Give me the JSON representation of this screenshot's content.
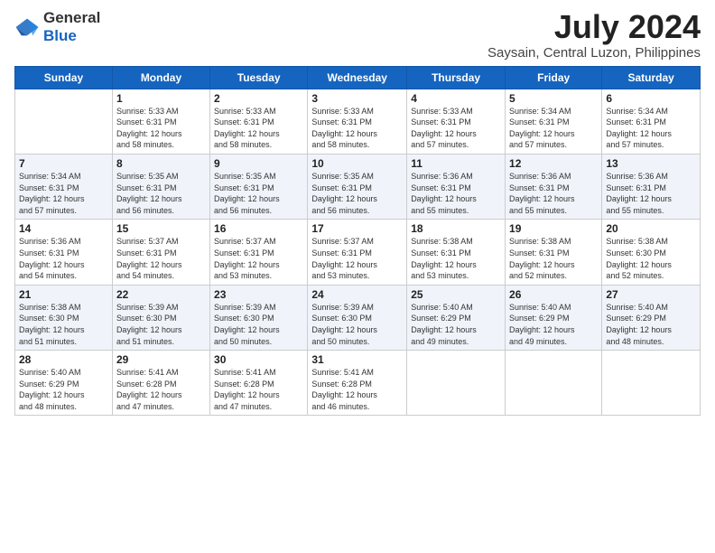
{
  "header": {
    "logo_general": "General",
    "logo_blue": "Blue",
    "month_year": "July 2024",
    "location": "Saysain, Central Luzon, Philippines"
  },
  "weekdays": [
    "Sunday",
    "Monday",
    "Tuesday",
    "Wednesday",
    "Thursday",
    "Friday",
    "Saturday"
  ],
  "weeks": [
    [
      {
        "day": "",
        "info": ""
      },
      {
        "day": "1",
        "info": "Sunrise: 5:33 AM\nSunset: 6:31 PM\nDaylight: 12 hours\nand 58 minutes."
      },
      {
        "day": "2",
        "info": "Sunrise: 5:33 AM\nSunset: 6:31 PM\nDaylight: 12 hours\nand 58 minutes."
      },
      {
        "day": "3",
        "info": "Sunrise: 5:33 AM\nSunset: 6:31 PM\nDaylight: 12 hours\nand 58 minutes."
      },
      {
        "day": "4",
        "info": "Sunrise: 5:33 AM\nSunset: 6:31 PM\nDaylight: 12 hours\nand 57 minutes."
      },
      {
        "day": "5",
        "info": "Sunrise: 5:34 AM\nSunset: 6:31 PM\nDaylight: 12 hours\nand 57 minutes."
      },
      {
        "day": "6",
        "info": "Sunrise: 5:34 AM\nSunset: 6:31 PM\nDaylight: 12 hours\nand 57 minutes."
      }
    ],
    [
      {
        "day": "7",
        "info": "Sunrise: 5:34 AM\nSunset: 6:31 PM\nDaylight: 12 hours\nand 57 minutes."
      },
      {
        "day": "8",
        "info": "Sunrise: 5:35 AM\nSunset: 6:31 PM\nDaylight: 12 hours\nand 56 minutes."
      },
      {
        "day": "9",
        "info": "Sunrise: 5:35 AM\nSunset: 6:31 PM\nDaylight: 12 hours\nand 56 minutes."
      },
      {
        "day": "10",
        "info": "Sunrise: 5:35 AM\nSunset: 6:31 PM\nDaylight: 12 hours\nand 56 minutes."
      },
      {
        "day": "11",
        "info": "Sunrise: 5:36 AM\nSunset: 6:31 PM\nDaylight: 12 hours\nand 55 minutes."
      },
      {
        "day": "12",
        "info": "Sunrise: 5:36 AM\nSunset: 6:31 PM\nDaylight: 12 hours\nand 55 minutes."
      },
      {
        "day": "13",
        "info": "Sunrise: 5:36 AM\nSunset: 6:31 PM\nDaylight: 12 hours\nand 55 minutes."
      }
    ],
    [
      {
        "day": "14",
        "info": "Sunrise: 5:36 AM\nSunset: 6:31 PM\nDaylight: 12 hours\nand 54 minutes."
      },
      {
        "day": "15",
        "info": "Sunrise: 5:37 AM\nSunset: 6:31 PM\nDaylight: 12 hours\nand 54 minutes."
      },
      {
        "day": "16",
        "info": "Sunrise: 5:37 AM\nSunset: 6:31 PM\nDaylight: 12 hours\nand 53 minutes."
      },
      {
        "day": "17",
        "info": "Sunrise: 5:37 AM\nSunset: 6:31 PM\nDaylight: 12 hours\nand 53 minutes."
      },
      {
        "day": "18",
        "info": "Sunrise: 5:38 AM\nSunset: 6:31 PM\nDaylight: 12 hours\nand 53 minutes."
      },
      {
        "day": "19",
        "info": "Sunrise: 5:38 AM\nSunset: 6:31 PM\nDaylight: 12 hours\nand 52 minutes."
      },
      {
        "day": "20",
        "info": "Sunrise: 5:38 AM\nSunset: 6:30 PM\nDaylight: 12 hours\nand 52 minutes."
      }
    ],
    [
      {
        "day": "21",
        "info": "Sunrise: 5:38 AM\nSunset: 6:30 PM\nDaylight: 12 hours\nand 51 minutes."
      },
      {
        "day": "22",
        "info": "Sunrise: 5:39 AM\nSunset: 6:30 PM\nDaylight: 12 hours\nand 51 minutes."
      },
      {
        "day": "23",
        "info": "Sunrise: 5:39 AM\nSunset: 6:30 PM\nDaylight: 12 hours\nand 50 minutes."
      },
      {
        "day": "24",
        "info": "Sunrise: 5:39 AM\nSunset: 6:30 PM\nDaylight: 12 hours\nand 50 minutes."
      },
      {
        "day": "25",
        "info": "Sunrise: 5:40 AM\nSunset: 6:29 PM\nDaylight: 12 hours\nand 49 minutes."
      },
      {
        "day": "26",
        "info": "Sunrise: 5:40 AM\nSunset: 6:29 PM\nDaylight: 12 hours\nand 49 minutes."
      },
      {
        "day": "27",
        "info": "Sunrise: 5:40 AM\nSunset: 6:29 PM\nDaylight: 12 hours\nand 48 minutes."
      }
    ],
    [
      {
        "day": "28",
        "info": "Sunrise: 5:40 AM\nSunset: 6:29 PM\nDaylight: 12 hours\nand 48 minutes."
      },
      {
        "day": "29",
        "info": "Sunrise: 5:41 AM\nSunset: 6:28 PM\nDaylight: 12 hours\nand 47 minutes."
      },
      {
        "day": "30",
        "info": "Sunrise: 5:41 AM\nSunset: 6:28 PM\nDaylight: 12 hours\nand 47 minutes."
      },
      {
        "day": "31",
        "info": "Sunrise: 5:41 AM\nSunset: 6:28 PM\nDaylight: 12 hours\nand 46 minutes."
      },
      {
        "day": "",
        "info": ""
      },
      {
        "day": "",
        "info": ""
      },
      {
        "day": "",
        "info": ""
      }
    ]
  ]
}
